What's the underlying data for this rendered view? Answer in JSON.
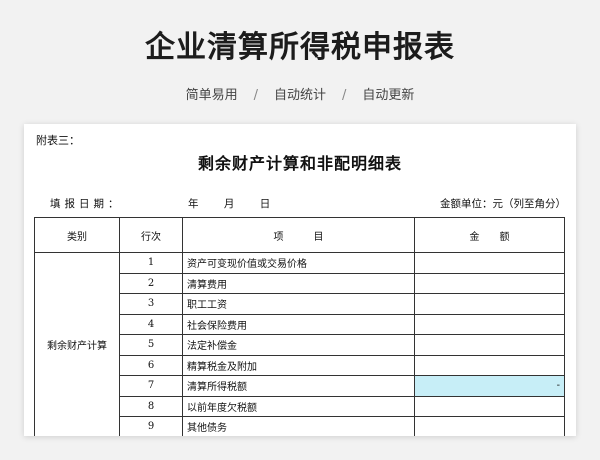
{
  "header": {
    "title": "企业清算所得税申报表",
    "features": [
      "简单易用",
      "自动统计",
      "自动更新"
    ],
    "separator": "/"
  },
  "form": {
    "attachment": "附表三：",
    "title": "剩余财产计算和非配明细表",
    "date_label": "填报日期：",
    "date_fields": [
      "年",
      "月",
      "日"
    ],
    "unit": "金额单位：元（列至角分）",
    "columns": [
      "类别",
      "行次",
      "项　　　目",
      "金　　额"
    ],
    "category": "剩余财产计算",
    "rows": [
      {
        "line": "1",
        "item": "资产可变现价值或交易价格",
        "amount": ""
      },
      {
        "line": "2",
        "item": "清算费用",
        "amount": ""
      },
      {
        "line": "3",
        "item": "职工工资",
        "amount": ""
      },
      {
        "line": "4",
        "item": "社会保险费用",
        "amount": ""
      },
      {
        "line": "5",
        "item": "法定补偿金",
        "amount": ""
      },
      {
        "line": "6",
        "item": "精算税金及附加",
        "amount": ""
      },
      {
        "line": "7",
        "item": "清算所得税额",
        "amount": "-"
      },
      {
        "line": "8",
        "item": "以前年度欠税额",
        "amount": ""
      },
      {
        "line": "9",
        "item": "其他债务",
        "amount": ""
      }
    ],
    "highlight_color": "#c7eef7"
  }
}
